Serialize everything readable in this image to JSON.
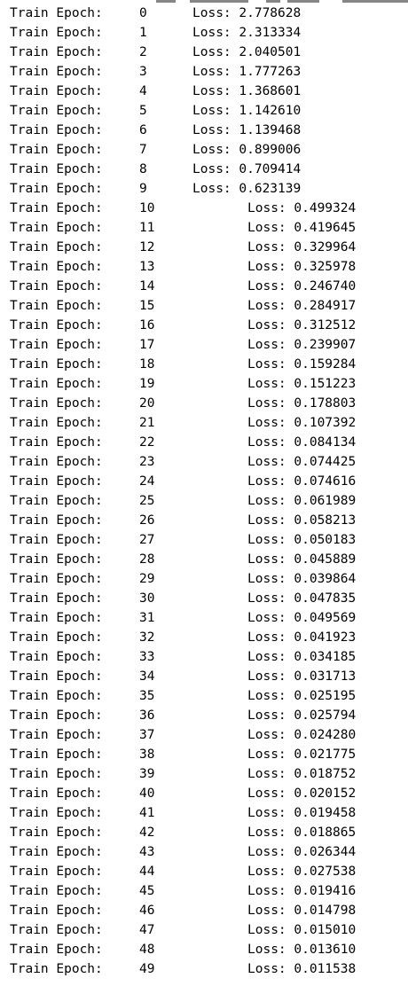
{
  "log": {
    "prefix": "Train Epoch:",
    "loss_label": "Loss:",
    "lines": [
      {
        "epoch": "0",
        "loss": "2.778628"
      },
      {
        "epoch": "1",
        "loss": "2.313334"
      },
      {
        "epoch": "2",
        "loss": "2.040501"
      },
      {
        "epoch": "3",
        "loss": "1.777263"
      },
      {
        "epoch": "4",
        "loss": "1.368601"
      },
      {
        "epoch": "5",
        "loss": "1.142610"
      },
      {
        "epoch": "6",
        "loss": "1.139468"
      },
      {
        "epoch": "7",
        "loss": "0.899006"
      },
      {
        "epoch": "8",
        "loss": "0.709414"
      },
      {
        "epoch": "9",
        "loss": "0.623139"
      },
      {
        "epoch": "10",
        "loss": "0.499324"
      },
      {
        "epoch": "11",
        "loss": "0.419645"
      },
      {
        "epoch": "12",
        "loss": "0.329964"
      },
      {
        "epoch": "13",
        "loss": "0.325978"
      },
      {
        "epoch": "14",
        "loss": "0.246740"
      },
      {
        "epoch": "15",
        "loss": "0.284917"
      },
      {
        "epoch": "16",
        "loss": "0.312512"
      },
      {
        "epoch": "17",
        "loss": "0.239907"
      },
      {
        "epoch": "18",
        "loss": "0.159284"
      },
      {
        "epoch": "19",
        "loss": "0.151223"
      },
      {
        "epoch": "20",
        "loss": "0.178803"
      },
      {
        "epoch": "21",
        "loss": "0.107392"
      },
      {
        "epoch": "22",
        "loss": "0.084134"
      },
      {
        "epoch": "23",
        "loss": "0.074425"
      },
      {
        "epoch": "24",
        "loss": "0.074616"
      },
      {
        "epoch": "25",
        "loss": "0.061989"
      },
      {
        "epoch": "26",
        "loss": "0.058213"
      },
      {
        "epoch": "27",
        "loss": "0.050183"
      },
      {
        "epoch": "28",
        "loss": "0.045889"
      },
      {
        "epoch": "29",
        "loss": "0.039864"
      },
      {
        "epoch": "30",
        "loss": "0.047835"
      },
      {
        "epoch": "31",
        "loss": "0.049569"
      },
      {
        "epoch": "32",
        "loss": "0.041923"
      },
      {
        "epoch": "33",
        "loss": "0.034185"
      },
      {
        "epoch": "34",
        "loss": "0.031713"
      },
      {
        "epoch": "35",
        "loss": "0.025195"
      },
      {
        "epoch": "36",
        "loss": "0.025794"
      },
      {
        "epoch": "37",
        "loss": "0.024280"
      },
      {
        "epoch": "38",
        "loss": "0.021775"
      },
      {
        "epoch": "39",
        "loss": "0.018752"
      },
      {
        "epoch": "40",
        "loss": "0.020152"
      },
      {
        "epoch": "41",
        "loss": "0.019458"
      },
      {
        "epoch": "42",
        "loss": "0.018865"
      },
      {
        "epoch": "43",
        "loss": "0.026344"
      },
      {
        "epoch": "44",
        "loss": "0.027538"
      },
      {
        "epoch": "45",
        "loss": "0.019416"
      },
      {
        "epoch": "46",
        "loss": "0.014798"
      },
      {
        "epoch": "47",
        "loss": "0.015010"
      },
      {
        "epoch": "48",
        "loss": "0.013610"
      },
      {
        "epoch": "49",
        "loss": "0.011538"
      }
    ]
  }
}
